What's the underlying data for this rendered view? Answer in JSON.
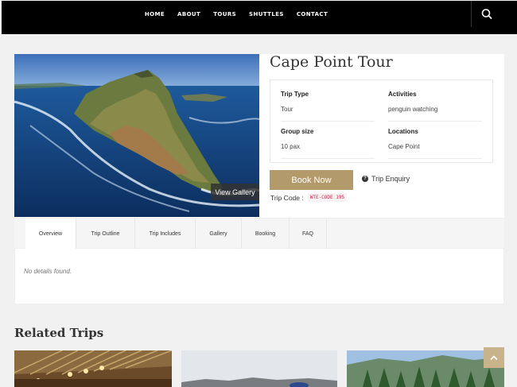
{
  "nav": {
    "links": [
      "HOME",
      "ABOUT",
      "TOURS",
      "SHUTTLES",
      "CONTACT"
    ]
  },
  "trip": {
    "title": "Cape Point Tour",
    "view_gallery": "View Gallery",
    "info": {
      "trip_type_label": "Trip Type",
      "trip_type_value": "Tour",
      "activities_label": "Activities",
      "activities_value": "penguin watching",
      "group_size_label": "Group size",
      "group_size_value": "10 pax",
      "locations_label": "Locations",
      "locations_value": "Cape Point"
    },
    "book_now": "Book Now",
    "enquiry": "Trip Enquiry",
    "trip_code_label": "Trip Code :",
    "trip_code_value": "WTE-CODE 195"
  },
  "tabs": [
    "Overview",
    "Trip Outline",
    "Trip Includes",
    "Gallery",
    "Booking",
    "FAQ"
  ],
  "active_tab": "Overview",
  "tab_content": {
    "empty_text": "No details found."
  },
  "related": {
    "title": "Related Trips"
  },
  "icons": {
    "search": "search-icon",
    "help": "question-circle-icon",
    "scroll_top": "chevron-up-icon"
  },
  "colors": {
    "nav_bg": "#000000",
    "book_button": "#b39a6b",
    "scroll_top": "#c9b38a",
    "code_text": "#c7254e"
  }
}
